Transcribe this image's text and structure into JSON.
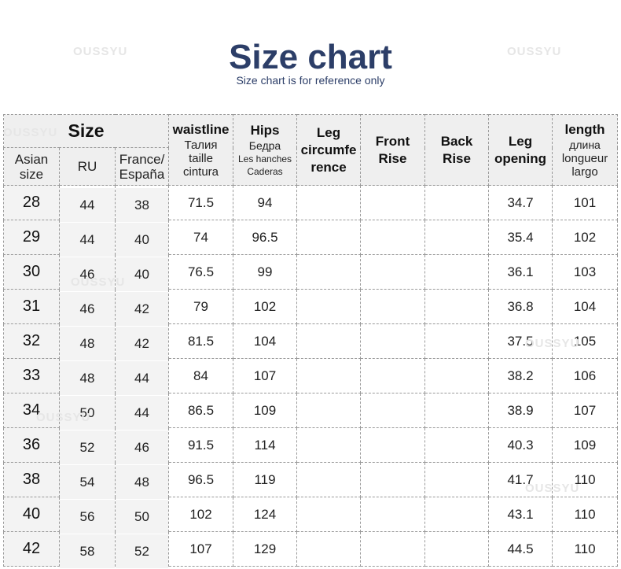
{
  "watermark": "OUSSYU",
  "title": "Size chart",
  "subtitle": "Size chart is for reference only",
  "header": {
    "size_group": "Size",
    "asian_size": [
      "Asian",
      "size"
    ],
    "ru": "RU",
    "france_espana": [
      "France/",
      "España"
    ],
    "waistline": {
      "label": "waistline",
      "sub": [
        "Талия",
        "taille",
        "cintura"
      ]
    },
    "hips": {
      "label": "Hips",
      "sub": [
        "Бедра",
        "Les hanches",
        "Caderas"
      ]
    },
    "leg_circumference": [
      "Leg",
      "circumfe",
      "rence"
    ],
    "front_rise": [
      "Front",
      "Rise"
    ],
    "back_rise": [
      "Back",
      "Rise"
    ],
    "leg_opening": [
      "Leg",
      "opening"
    ],
    "length": {
      "label": "length",
      "sub": [
        "длина",
        "longueur",
        "largo"
      ]
    }
  },
  "rows": [
    {
      "asian": "28",
      "ru": "44",
      "fr": "38",
      "waist": "71.5",
      "hips": "94",
      "leg_circ": "",
      "front_rise": "",
      "back_rise": "",
      "leg_opening": "34.7",
      "length": "101"
    },
    {
      "asian": "29",
      "ru": "44",
      "fr": "40",
      "waist": "74",
      "hips": "96.5",
      "leg_circ": "",
      "front_rise": "",
      "back_rise": "",
      "leg_opening": "35.4",
      "length": "102"
    },
    {
      "asian": "30",
      "ru": "46",
      "fr": "40",
      "waist": "76.5",
      "hips": "99",
      "leg_circ": "",
      "front_rise": "",
      "back_rise": "",
      "leg_opening": "36.1",
      "length": "103"
    },
    {
      "asian": "31",
      "ru": "46",
      "fr": "42",
      "waist": "79",
      "hips": "102",
      "leg_circ": "",
      "front_rise": "",
      "back_rise": "",
      "leg_opening": "36.8",
      "length": "104"
    },
    {
      "asian": "32",
      "ru": "48",
      "fr": "42",
      "waist": "81.5",
      "hips": "104",
      "leg_circ": "",
      "front_rise": "",
      "back_rise": "",
      "leg_opening": "37.5",
      "length": "105"
    },
    {
      "asian": "33",
      "ru": "48",
      "fr": "44",
      "waist": "84",
      "hips": "107",
      "leg_circ": "",
      "front_rise": "",
      "back_rise": "",
      "leg_opening": "38.2",
      "length": "106"
    },
    {
      "asian": "34",
      "ru": "50",
      "fr": "44",
      "waist": "86.5",
      "hips": "109",
      "leg_circ": "",
      "front_rise": "",
      "back_rise": "",
      "leg_opening": "38.9",
      "length": "107"
    },
    {
      "asian": "36",
      "ru": "52",
      "fr": "46",
      "waist": "91.5",
      "hips": "114",
      "leg_circ": "",
      "front_rise": "",
      "back_rise": "",
      "leg_opening": "40.3",
      "length": "109"
    },
    {
      "asian": "38",
      "ru": "54",
      "fr": "48",
      "waist": "96.5",
      "hips": "119",
      "leg_circ": "",
      "front_rise": "",
      "back_rise": "",
      "leg_opening": "41.7",
      "length": "110"
    },
    {
      "asian": "40",
      "ru": "56",
      "fr": "50",
      "waist": "102",
      "hips": "124",
      "leg_circ": "",
      "front_rise": "",
      "back_rise": "",
      "leg_opening": "43.1",
      "length": "110"
    },
    {
      "asian": "42",
      "ru": "58",
      "fr": "52",
      "waist": "107",
      "hips": "129",
      "leg_circ": "",
      "front_rise": "",
      "back_rise": "",
      "leg_opening": "44.5",
      "length": "110"
    }
  ],
  "colors": {
    "title": "#2c3e68",
    "header_bg": "#efefef",
    "border": "#9a9a9a",
    "watermark": "#e6e6e6"
  }
}
